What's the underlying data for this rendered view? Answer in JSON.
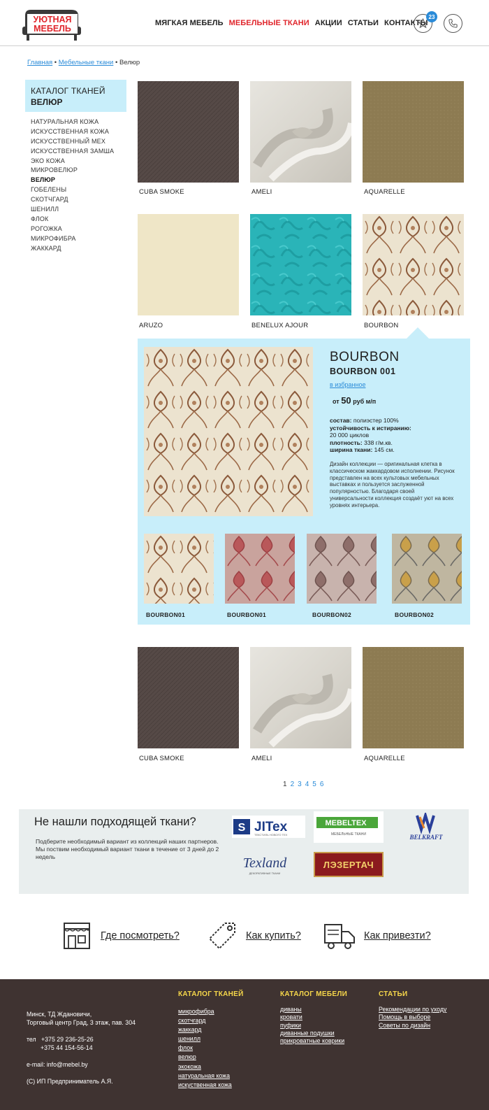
{
  "header": {
    "logo_line1": "УЮТНАЯ",
    "logo_line2": "МЕБЕЛЬ",
    "nav": [
      {
        "label": "МЯГКАЯ МЕБЕЛЬ",
        "active": false
      },
      {
        "label": "МЕБЕЛЬНЫЕ ТКАНИ",
        "active": true
      },
      {
        "label": "АКЦИИ",
        "active": false
      },
      {
        "label": "СТАТЬИ",
        "active": false
      },
      {
        "label": "КОНТАКТЫ",
        "active": false
      }
    ],
    "favorites_count": "23",
    "fav_icon": "star-icon",
    "phone_icon": "phone-icon"
  },
  "breadcrumb": {
    "home": "Главная",
    "sep1": " • ",
    "section": "Мебельные ткани",
    "sep2": " • ",
    "current": "Велюр"
  },
  "sidebar": {
    "title": "КАТАЛОГ ТКАНЕЙ",
    "subtitle": "ВЕЛЮР",
    "items": [
      "НАТУРАЛЬНАЯ КОЖА",
      "ИСКУССТВЕННАЯ КОЖА",
      "ИСКУССТВЕННЫЙ МЕХ",
      "ИСКУССТВЕННАЯ ЗАМША",
      "ЭКО КОЖА",
      "МИКРОВЕЛЮР",
      "ВЕЛЮР",
      "ГОБЕЛЕНЫ",
      "СКОТЧГАРД",
      "ШЕНИЛЛ",
      "ФЛОК",
      "РОГОЖКА",
      "МИКРОФИБРА",
      "ЖАККАРД"
    ],
    "active_item": "ВЕЛЮР"
  },
  "grid": {
    "row1": [
      "CUBA SMOKE",
      "AMELI",
      "AQUARELLE"
    ],
    "row2": [
      "ARUZO",
      "BENELUX AJOUR",
      "BOURBON"
    ],
    "row3": [
      "CUBA SMOKE",
      "AMELI",
      "AQUARELLE"
    ]
  },
  "detail": {
    "name": "BOURBON",
    "code": "BOURBON 001",
    "fav_link": "в избранное",
    "price_prefix": "от",
    "price_value": "50",
    "price_unit": "руб м/п",
    "composition_label": "состав:",
    "composition_value": "полиэстер 100%",
    "abrasion_label": "устойчивость к истиранию:",
    "abrasion_value": "20 000 циклов",
    "density_label": "плотность:",
    "density_value": "338 г/м.кв.",
    "width_label": "ширина ткани:",
    "width_value": "145 см.",
    "description": "Дизайн коллекции — оригинальная клетка в классическом жаккардовом исполнении. Рисунок представлен на всех культовых мебельных выставках и пользуется заслуженной популярностью. Благодаря своей универсальности коллекция создаёт уют на всех уровнях интерьера.",
    "swatches": [
      "BOURBON01",
      "BOURBON01",
      "BOURBON02",
      "BOURBON02"
    ]
  },
  "pagination": [
    "1",
    "2",
    "3",
    "4",
    "5",
    "6"
  ],
  "partners": {
    "title": "Не нашли подходящей ткани?",
    "text": "Подберите необходимый вариант из коллекций наших партнеров. Мы поствим необходимый вариант ткани в течение от 3 дней до 2 недель",
    "logos": {
      "jitex": "JITex",
      "jitex_sub": "ТЕКСТИЛЬ НОВОГО ТЕХ",
      "mebeltex": "MEBELTEX",
      "mebeltex_sub": "МЕБЕЛЬНЫЕ ТКАНИ",
      "belkraft": "BELKRAFT",
      "texland": "Texland",
      "texland_sub": "ДЕКОРАТИВНЫЕ ТКАНИ",
      "lazertach": "ЛЭЗЕРТАЧ"
    }
  },
  "info": {
    "where": "Где посмотреть?",
    "how_buy": "Как купить?",
    "delivery": "Как привезти?"
  },
  "footer": {
    "address_line1": "Минск, ТД Ждановичи,",
    "address_line2": "Торговый центр Град, 3 этаж, пав. 304",
    "phone_label": "тел",
    "phone1": "+375 29 236-25-26",
    "phone2": "+375 44 154-56-14",
    "email": "e-mail: info@mebel.by",
    "copyright": "(С) ИП Предприниматель А.Я.",
    "col1_title": "КАТАЛОГ ТКАНЕЙ",
    "col1": [
      "микрофибра",
      "скотчгард",
      "жаккард",
      "шенилл",
      "флок",
      "велюр",
      "экокожа",
      "натуральная кожа",
      "искуственная кожа"
    ],
    "col2_title": "КАТАЛОГ МЕБЕЛИ",
    "col2": [
      "диваны",
      "кровати",
      "пуфики",
      "диванные подушки",
      "прикроватные коврики"
    ],
    "col3_title": "СТАТЬИ",
    "col3": [
      "Рекомендации по уходу",
      "Помощь в выборе",
      "Советы по дизайн"
    ]
  },
  "colors": {
    "accent_red": "#e0262c",
    "link_blue": "#2a8bd8",
    "panel_blue": "#c8eefa",
    "footer_bg": "#3f3331",
    "footer_heading": "#f6d74a"
  }
}
